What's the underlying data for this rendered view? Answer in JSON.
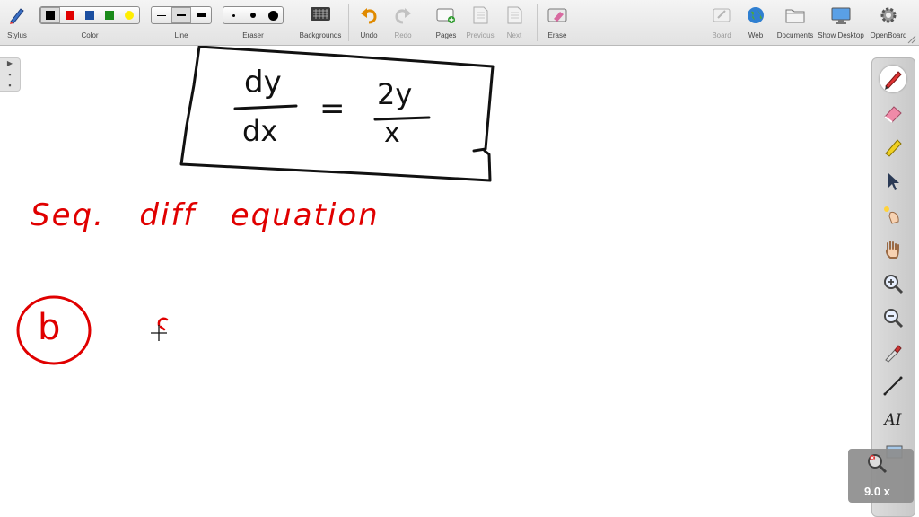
{
  "toolbar": {
    "stylus": "Stylus",
    "color": "Color",
    "line": "Line",
    "eraser": "Eraser",
    "backgrounds": "Backgrounds",
    "undo": "Undo",
    "redo": "Redo",
    "pages": "Pages",
    "previous": "Previous",
    "next": "Next",
    "erase": "Erase",
    "board": "Board",
    "web": "Web",
    "documents": "Documents",
    "show_desktop": "Show Desktop",
    "openboard": "OpenBoard",
    "colors": [
      "#000000",
      "#e00000",
      "#1c4fa0",
      "#1a8a1a",
      "#ffee00"
    ]
  },
  "board": {
    "numerator_left": "dy",
    "denominator_left": "dx",
    "equals": "=",
    "numerator_right": "2y",
    "denominator_right": "x",
    "note": "Seq.   diff   equation",
    "circle_label": "b"
  },
  "palette": {
    "tools": [
      "pen-icon",
      "eraser-icon",
      "highlighter-icon",
      "pointer-icon",
      "laser-icon",
      "hand-icon",
      "zoom-in-icon",
      "zoom-out-icon",
      "color-picker-icon",
      "line-icon",
      "text-icon",
      "capture-icon"
    ],
    "text_tool": "AI"
  },
  "zoom": {
    "level": "9.0 x"
  },
  "ink": {
    "black": "#111111",
    "red": "#e00000"
  }
}
